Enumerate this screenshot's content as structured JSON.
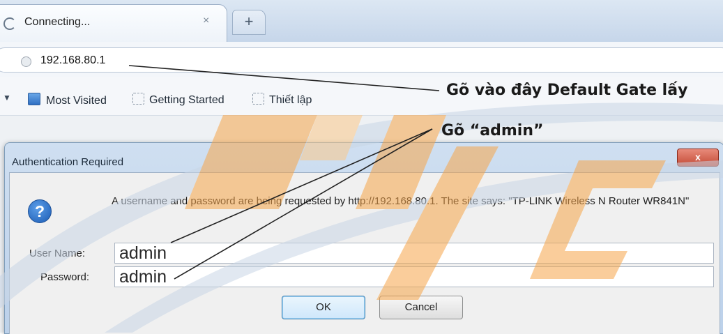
{
  "browser": {
    "tab": {
      "title": "Connecting...",
      "close_glyph": "×",
      "icon": "loading-spinner-icon"
    },
    "new_tab_glyph": "+",
    "url": "192.168.80.1",
    "bookmarks": [
      {
        "label": "Most Visited",
        "icon": "most-visited-icon"
      },
      {
        "label": "Getting Started",
        "icon": "bookmark-icon"
      },
      {
        "label": "Thiết lập",
        "icon": "bookmark-icon"
      }
    ]
  },
  "dialog": {
    "title": "Authentication Required",
    "close_glyph": "x",
    "icon": "question-icon",
    "message": "A username and password are being requested by http://192.168.80.1. The site says: \"TP-LINK Wireless N Router WR841N\"",
    "username_label": "User Name:",
    "username_value": "admin",
    "password_label": "Password:",
    "password_value": "admin",
    "ok_label": "OK",
    "cancel_label": "Cancel"
  },
  "annotations": {
    "default_gateway_note": "Gõ vào đây Default Gate lấy",
    "admin_note": "Gõ “admin”"
  },
  "colors": {
    "watermark_orange": "#f7a64a",
    "watermark_blue": "#c9d6e6",
    "dialog_frame": "#bcd1ea",
    "close_red": "#c34a35"
  }
}
